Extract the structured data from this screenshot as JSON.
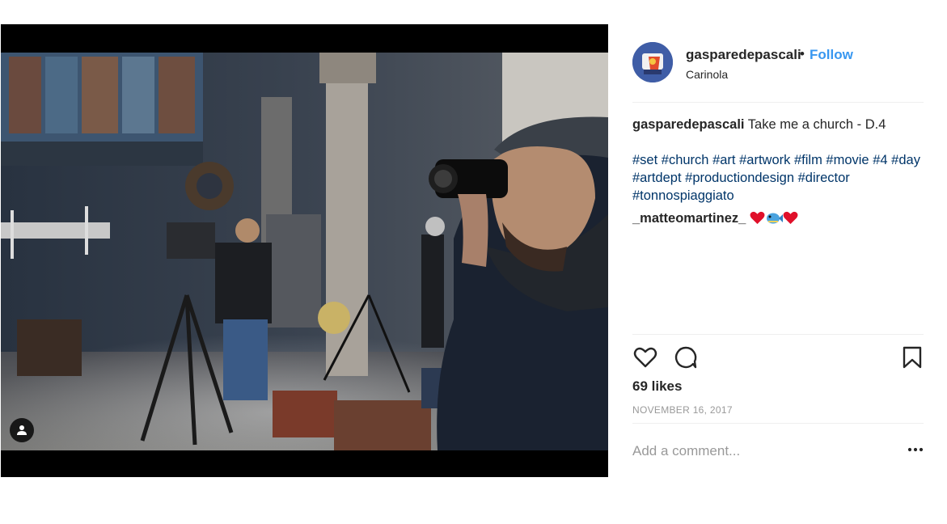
{
  "post": {
    "username": "gasparedepascali",
    "separator": "•",
    "follow_label": "Follow",
    "location": "Carinola",
    "caption_text": "Take me a church - D.4",
    "hashtags": [
      "#set",
      "#church",
      "#art",
      "#artwork",
      "#film",
      "#movie",
      "#4",
      "#day",
      "#artdept",
      "#productiondesign",
      "#director",
      "#tonnospiaggiato"
    ],
    "comment": {
      "username": "_matteomartinez_",
      "emojis": [
        "red-heart",
        "blowfish",
        "red-heart"
      ]
    },
    "likes": "69 likes",
    "date": "NOVEMBER 16, 2017",
    "add_comment_placeholder": "Add a comment..."
  },
  "icons": {
    "heart": "heart-outline-icon",
    "comment": "comment-bubble-icon",
    "bookmark": "bookmark-icon",
    "more": "more-dots-icon",
    "tagged_user": "user-tag-icon"
  },
  "colors": {
    "follow": "#3897f0",
    "hashtag": "#003569",
    "muted": "#999999",
    "text": "#262626"
  }
}
